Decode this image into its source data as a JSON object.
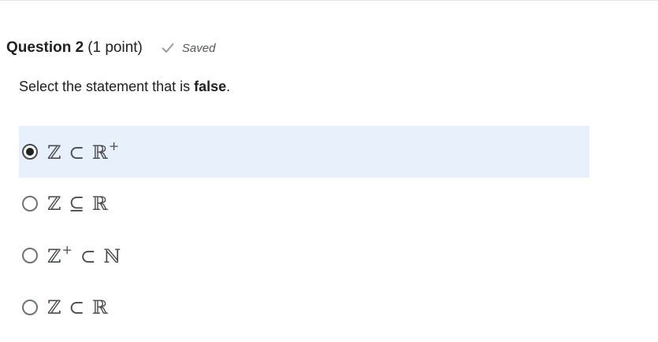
{
  "question": {
    "title": "Question 2",
    "points": "(1 point)",
    "status_text": "Saved",
    "status_icon": "checkmark-icon",
    "prompt_before": "Select the statement that is ",
    "prompt_emphasis": "false",
    "prompt_after": "."
  },
  "options": [
    {
      "base": "ℤ ⊂ ℝ",
      "sup": "+",
      "selected": true
    },
    {
      "base": "ℤ ⊆ ℝ",
      "sup": "",
      "selected": false
    },
    {
      "base_left": "ℤ",
      "sup_left": "+",
      "base_right": " ⊂ ℕ",
      "selected": false
    },
    {
      "base": "ℤ ⊂ ℝ",
      "sup": "",
      "selected": false
    }
  ],
  "colors": {
    "selected_background": "#e8f1fb",
    "text": "#202122",
    "muted": "#565a5c"
  }
}
